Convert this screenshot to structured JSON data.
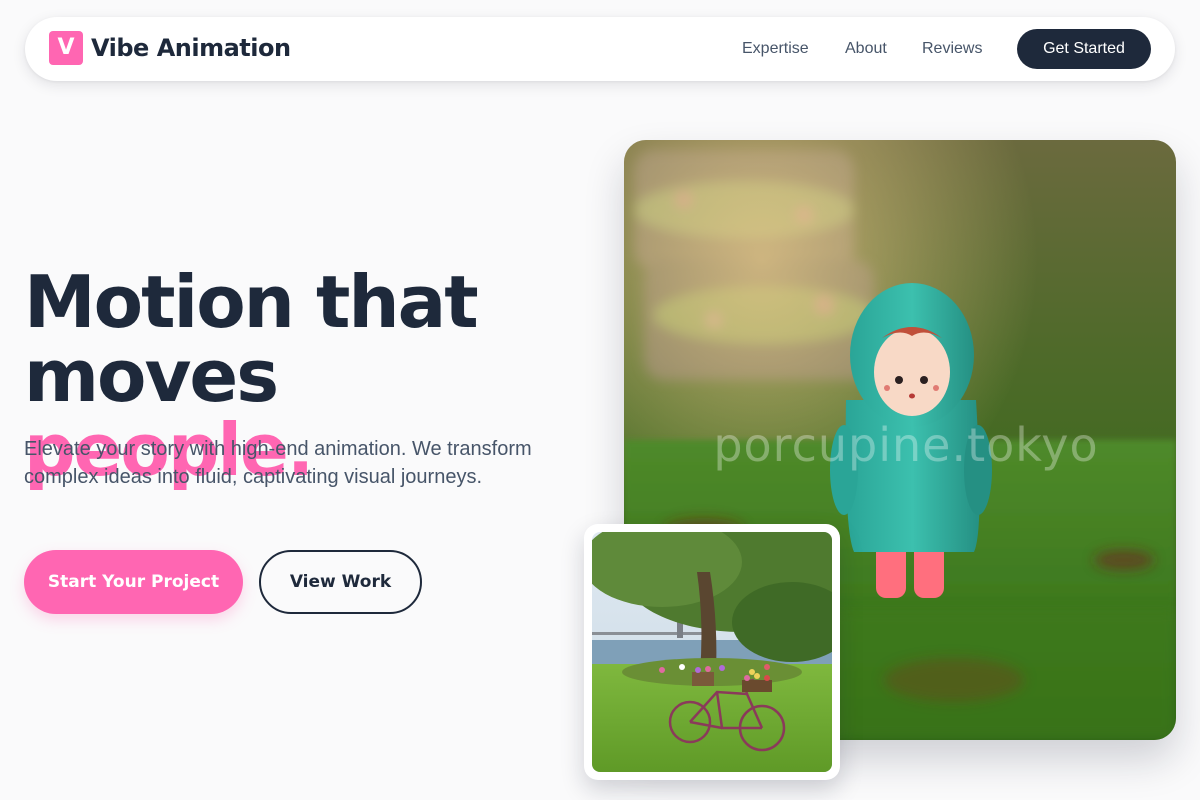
{
  "nav": {
    "logo_letter": "V",
    "brand": "Vibe Animation",
    "links": [
      "Expertise",
      "About",
      "Reviews"
    ],
    "cta": "Get Started"
  },
  "hero": {
    "headline_line1": "Motion that",
    "headline_line2_plain": "moves ",
    "headline_line2_accent": "people.",
    "subtitle": "Elevate your story with high-end animation. We transform complex ideas into fluid, captivating visual journeys.",
    "primary_button": "Start Your Project",
    "secondary_button": "View Work"
  },
  "images": {
    "main_watermark": "porcupine.tokyo"
  },
  "colors": {
    "accent": "#ff66b2",
    "dark": "#1e293b",
    "muted_text": "#475569",
    "background": "#fafafb"
  }
}
